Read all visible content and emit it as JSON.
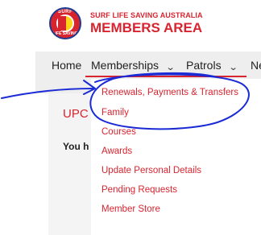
{
  "header": {
    "logo_top_text": "SURF",
    "logo_bottom_text": "LIFE SAVING",
    "org_name": "SURF LIFE SAVING AUSTRALIA",
    "site_title": "MEMBERS AREA"
  },
  "nav": {
    "items": [
      {
        "label": "Home"
      },
      {
        "label": "Memberships"
      },
      {
        "label": "Patrols"
      },
      {
        "label": "Ne"
      }
    ]
  },
  "page": {
    "heading_partial": "UPC",
    "subtext_partial": "You h"
  },
  "dropdown": {
    "items": [
      {
        "label": "Renewals, Payments & Transfers"
      },
      {
        "label": "Family"
      },
      {
        "label": "Courses"
      },
      {
        "label": "Awards"
      },
      {
        "label": "Update Personal Details"
      },
      {
        "label": "Pending Requests"
      },
      {
        "label": "Member Store"
      }
    ]
  },
  "colors": {
    "brand_red": "#d7242f",
    "annotation_blue": "#1a2bd6",
    "navbar_gray": "#eeeeee"
  }
}
